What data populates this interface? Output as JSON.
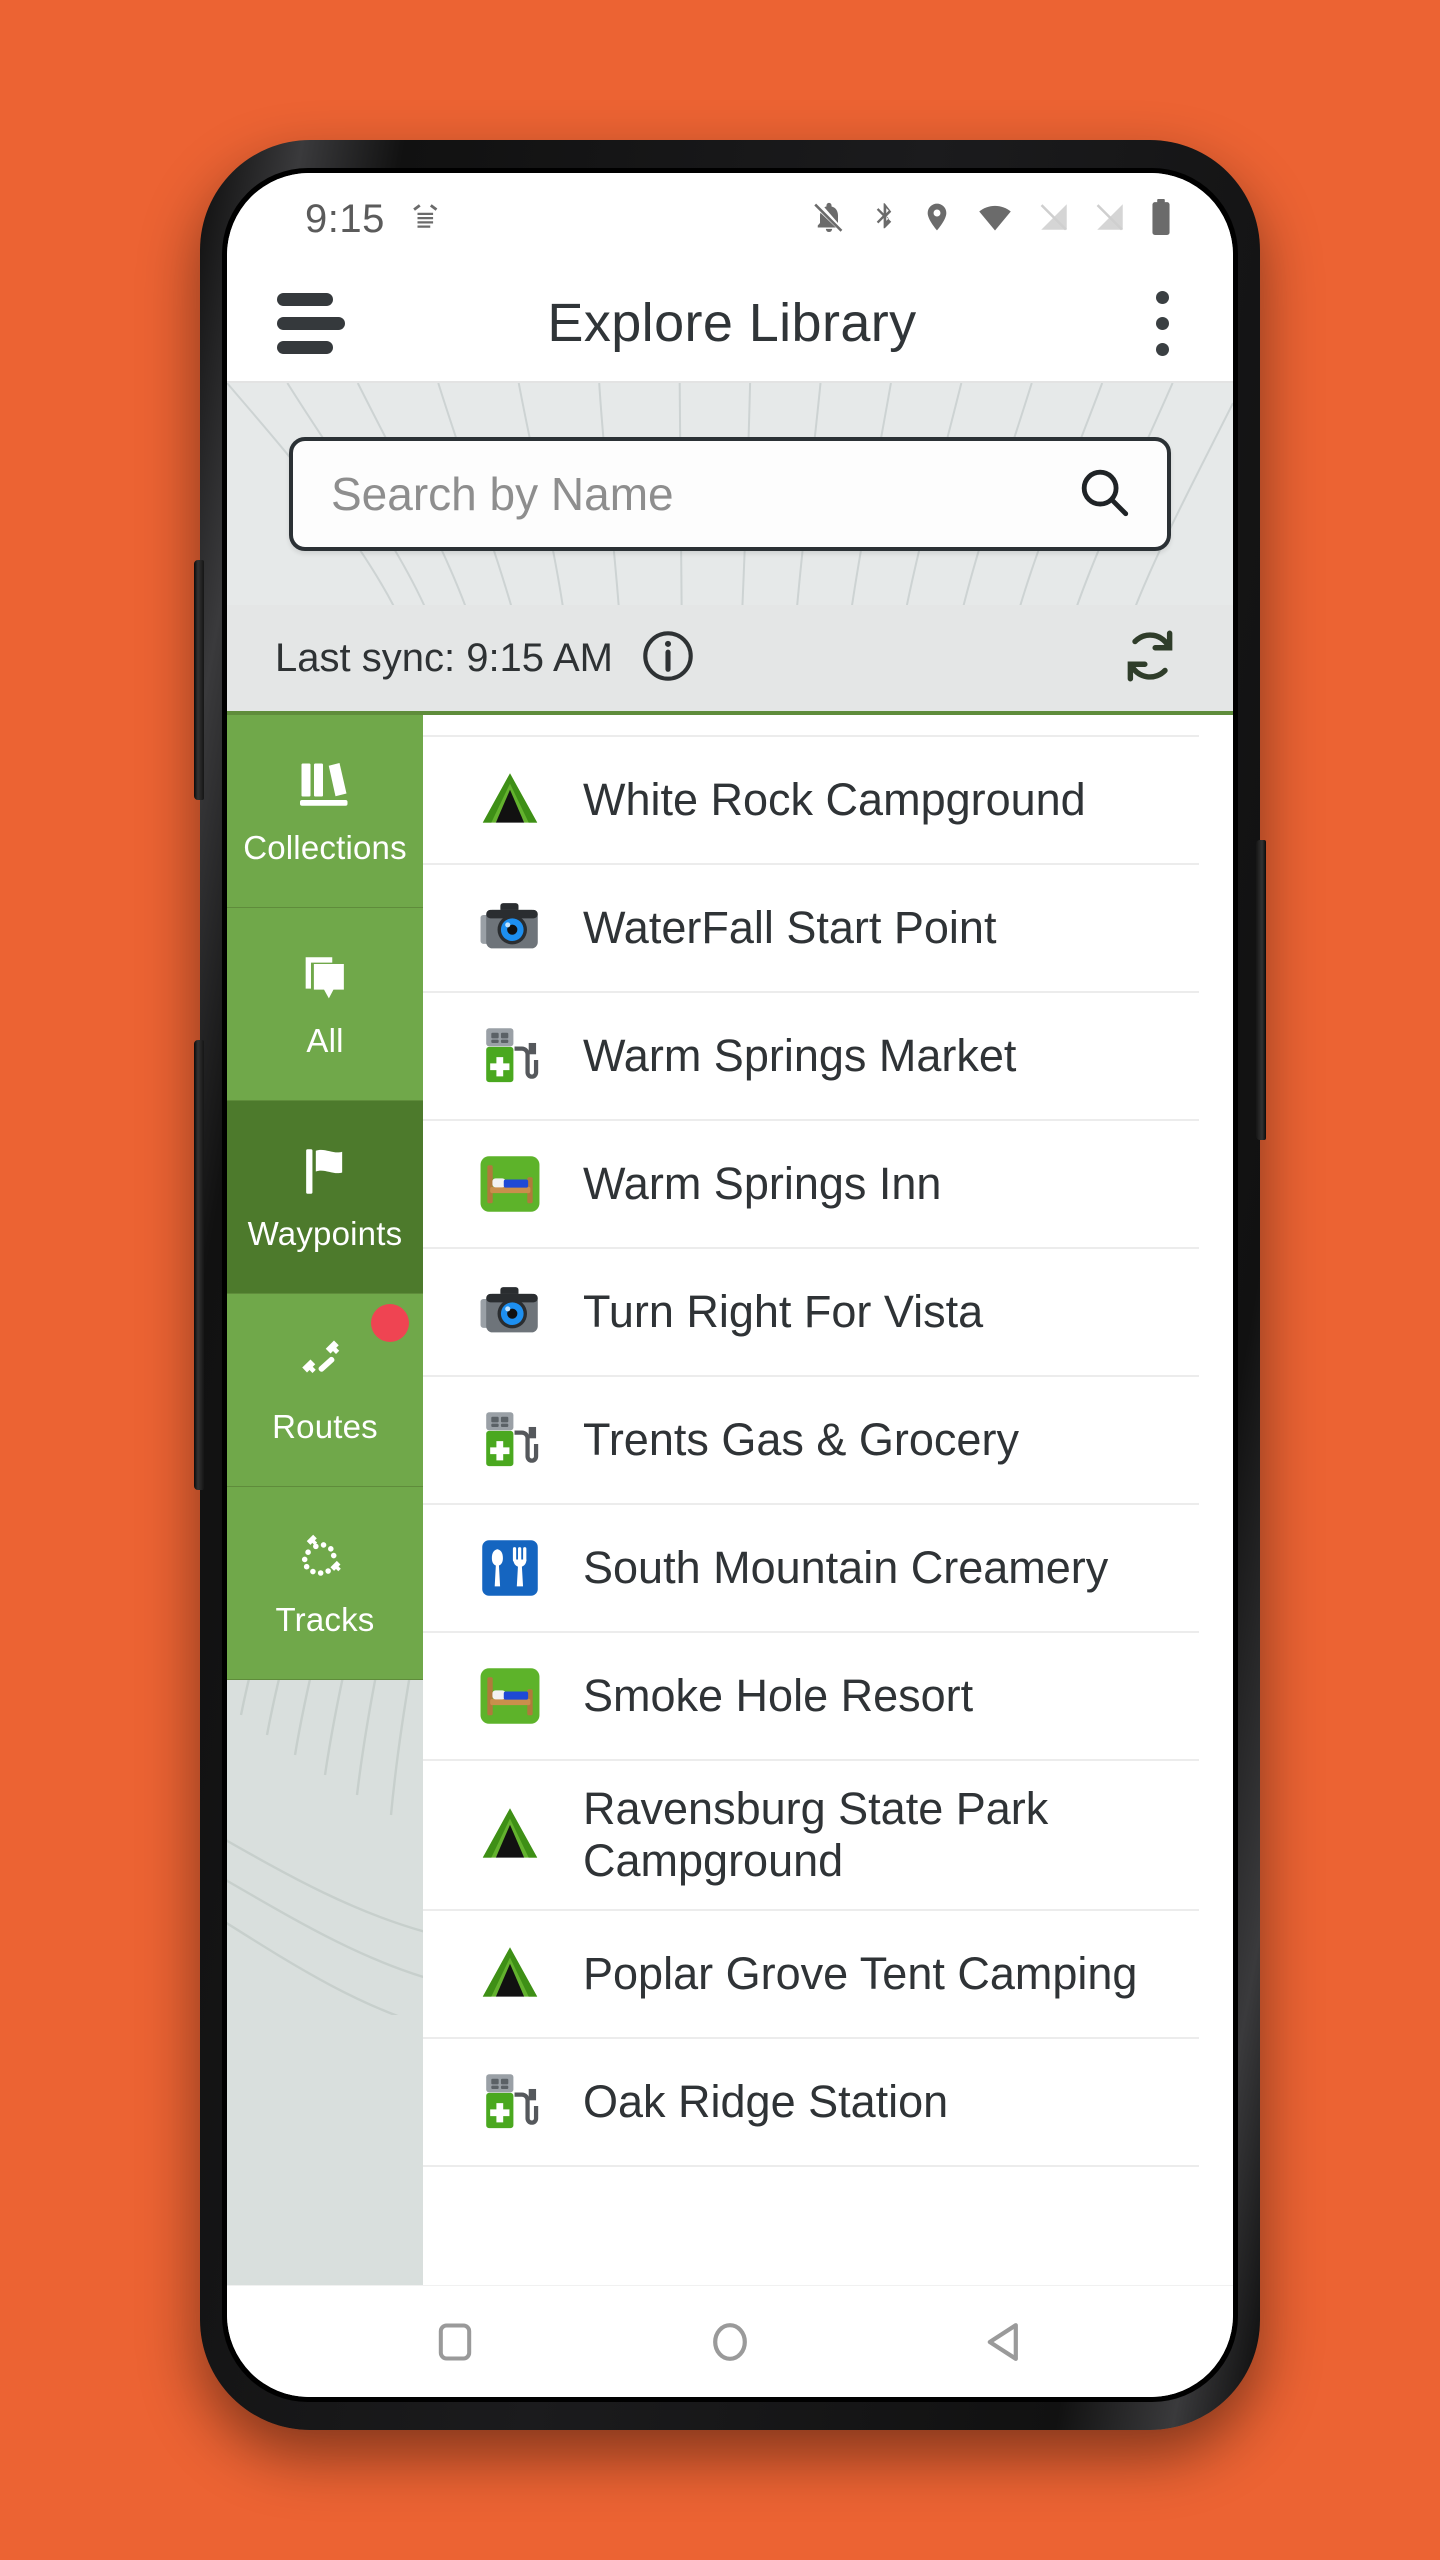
{
  "theme": {
    "page_background": "#EC6333",
    "accent_green": "#70a84a",
    "accent_green_selected": "#4d7a2c",
    "badge_red": "#ef4452",
    "divider_green": "#5f8c3b"
  },
  "status_bar": {
    "time": "9:15",
    "left_icons": [
      "alarm-ring-icon"
    ],
    "right_icons": [
      "notifications-off-icon",
      "bluetooth-icon",
      "location-icon",
      "wifi-icon",
      "sim-off-icon",
      "sim-off-icon",
      "battery-full-icon"
    ]
  },
  "app_bar": {
    "menu_icon": "hamburger-menu-icon",
    "title": "Explore Library",
    "overflow_icon": "more-vertical-icon"
  },
  "search": {
    "placeholder": "Search by Name",
    "value": "",
    "icon": "search-icon"
  },
  "sync": {
    "text": "Last sync: 9:15 AM",
    "info_icon": "info-circle-icon",
    "refresh_icon": "sync-refresh-icon"
  },
  "sidebar": {
    "tabs": [
      {
        "label": "Collections",
        "icon": "books-collection-icon",
        "selected": false,
        "badge": false
      },
      {
        "label": "All",
        "icon": "layers-pin-icon",
        "selected": false,
        "badge": false
      },
      {
        "label": "Waypoints",
        "icon": "flag-icon",
        "selected": true,
        "badge": false
      },
      {
        "label": "Routes",
        "icon": "route-pins-icon",
        "selected": false,
        "badge": true
      },
      {
        "label": "Tracks",
        "icon": "track-dots-icon",
        "selected": false,
        "badge": false
      }
    ]
  },
  "list": {
    "items": [
      {
        "label": "White Rock Campground",
        "icon": "tent-campground-icon"
      },
      {
        "label": "WaterFall Start Point",
        "icon": "camera-scenic-icon"
      },
      {
        "label": "Warm Springs Market",
        "icon": "gas-station-icon"
      },
      {
        "label": "Warm Springs Inn",
        "icon": "lodging-bed-icon"
      },
      {
        "label": "Turn Right For Vista",
        "icon": "camera-scenic-icon"
      },
      {
        "label": "Trents Gas & Grocery",
        "icon": "gas-station-icon"
      },
      {
        "label": "South Mountain Creamery",
        "icon": "restaurant-icon"
      },
      {
        "label": "Smoke Hole Resort",
        "icon": "lodging-bed-icon"
      },
      {
        "label": "Ravensburg State Park Campground",
        "icon": "tent-campground-icon"
      },
      {
        "label": "Poplar Grove Tent Camping",
        "icon": "tent-campground-icon"
      },
      {
        "label": "Oak Ridge Station",
        "icon": "gas-station-icon"
      }
    ]
  },
  "nav_bar": {
    "buttons": [
      {
        "name": "recents-button",
        "icon": "square-icon"
      },
      {
        "name": "home-button",
        "icon": "circle-icon"
      },
      {
        "name": "back-button",
        "icon": "triangle-back-icon"
      }
    ]
  }
}
